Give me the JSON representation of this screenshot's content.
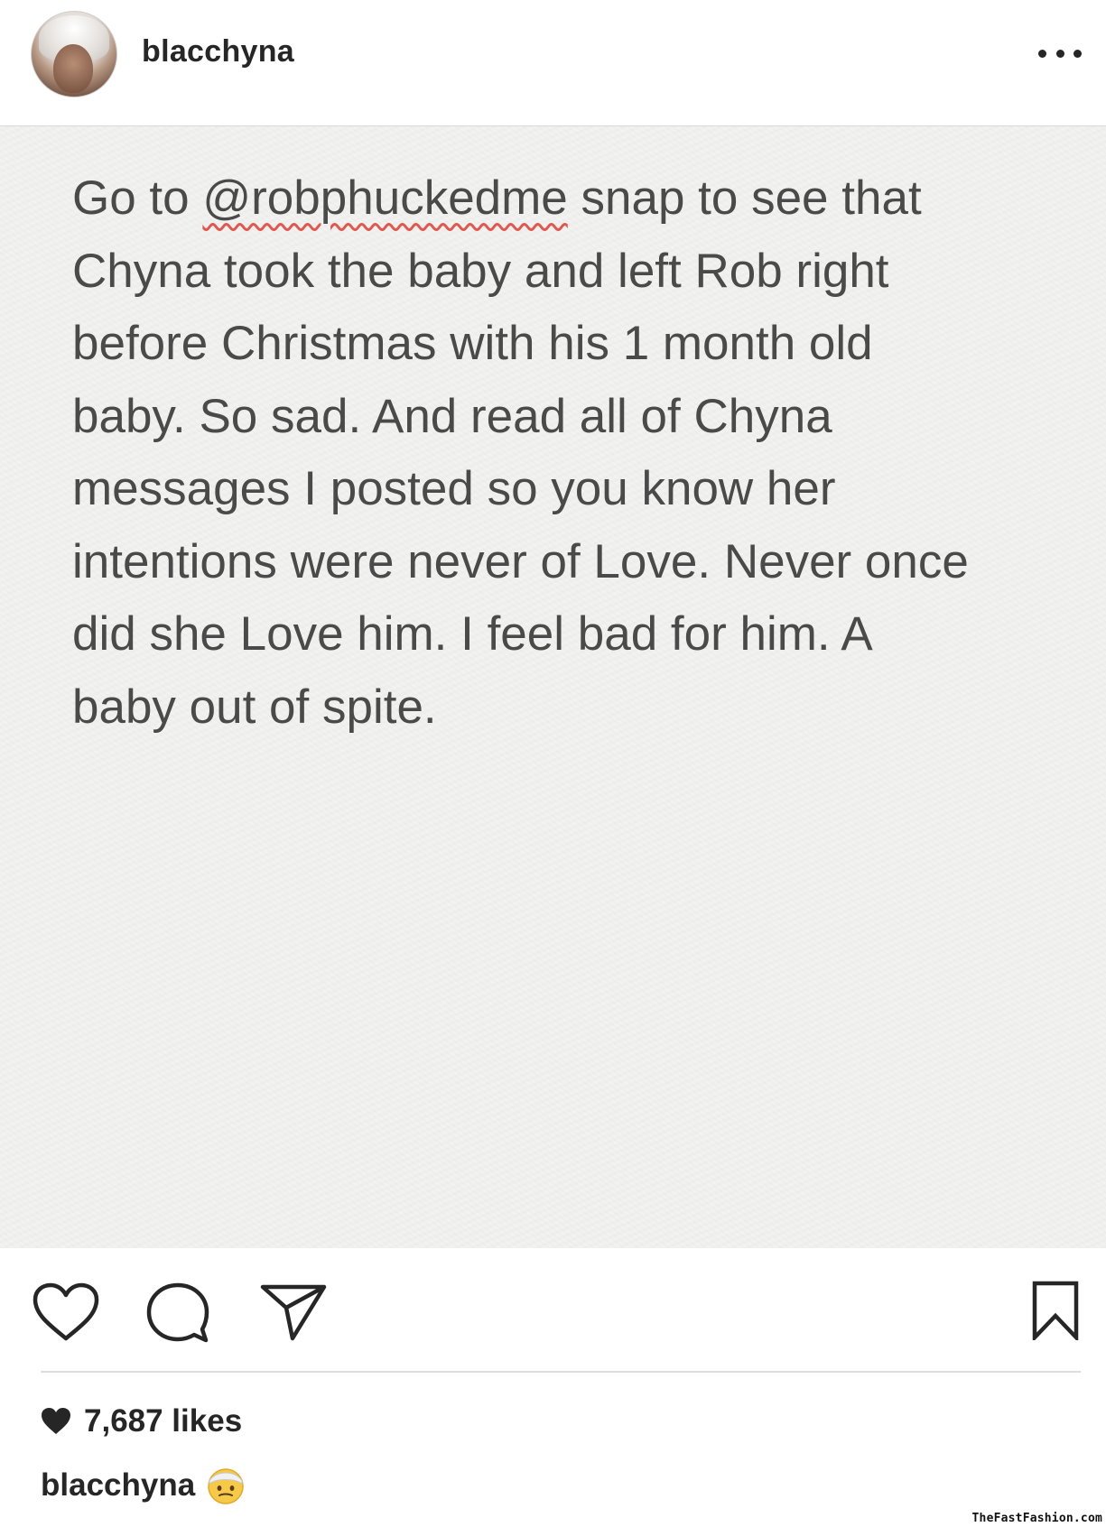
{
  "header": {
    "username": "blacchyna",
    "more_icon": "more-horizontal-icon"
  },
  "post": {
    "text_before_mention": "Go to ",
    "mention": "@robphuckedme",
    "text_after_mention": " snap to see that\nChyna took the baby and left Rob right\nbefore Christmas with his 1 month old\nbaby. So sad. And read all of Chyna\nmessages I posted so you know her\nintentions were never of Love. Never once\ndid she Love him. I feel bad for him. A\nbaby out of spite."
  },
  "actions": {
    "icons": [
      "heart-outline-icon",
      "comment-icon",
      "share-icon",
      "bookmark-icon"
    ]
  },
  "likes": {
    "icon": "heart-filled-icon",
    "count_label": "7,687 likes"
  },
  "caption": {
    "username": "blacchyna",
    "emoji": "face-with-head-bandage-emoji"
  },
  "watermark": "TheFastFashion.com"
}
